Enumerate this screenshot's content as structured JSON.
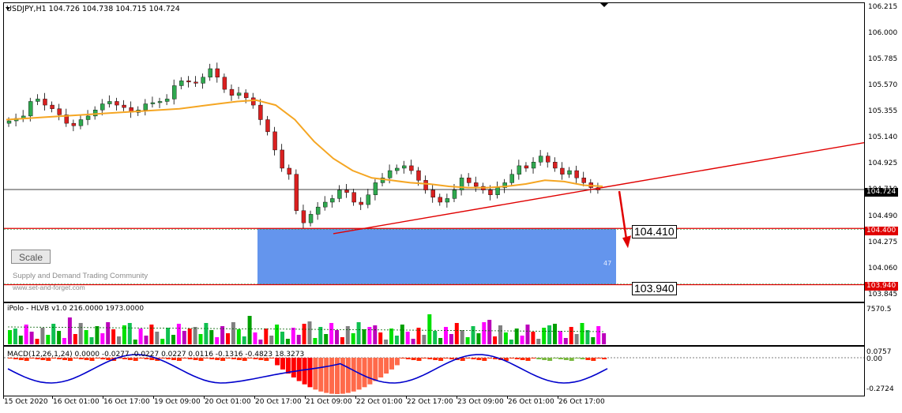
{
  "symbol_header": {
    "text": "USDJPY,H1  104.726 104.738 104.715 104.724"
  },
  "scale_button": {
    "label": "Scale"
  },
  "watermark": {
    "line1": "Supply and Demand Trading Community",
    "line2": "www.set-and-forget.com"
  },
  "zone": {
    "top_label": "104.410",
    "bottom_label": "103.940",
    "count_label": "47",
    "fill_color": "#6495ed"
  },
  "price_tags": {
    "current": "104.724",
    "zone_top": "104.400",
    "zone_bottom": "103.940"
  },
  "price_axis": [
    "106.215",
    "106.000",
    "105.785",
    "105.570",
    "105.355",
    "105.140",
    "104.925",
    "104.710",
    "104.490",
    "104.275",
    "104.060",
    "103.845"
  ],
  "volume_pane": {
    "header": "iPolo - HLVB v1.0 216.0000 1973.0000",
    "axis_max": "7570.5"
  },
  "macd_pane": {
    "header": "MACD(12,26,1,24) 0.0000 -0.0277 -0.0227 0.0227 0.0116 -0.1316 -0.4823 18.3273",
    "axis_top": "0.0757",
    "axis_zero": "0.00",
    "axis_bottom": "-0.2724"
  },
  "time_axis": [
    "15 Oct 2020",
    "16 Oct 01:00",
    "16 Oct 17:00",
    "19 Oct 09:00",
    "20 Oct 01:00",
    "20 Oct 17:00",
    "21 Oct 09:00",
    "22 Oct 01:00",
    "22 Oct 17:00",
    "23 Oct 09:00",
    "26 Oct 01:00",
    "26 Oct 17:00"
  ],
  "colors": {
    "bull_candle": "#2fa84f",
    "bear_candle": "#d92020",
    "moving_average": "#f5a623",
    "trendline": "#e00000",
    "macd_line": "#0000cc",
    "macd_hist_neg": "#ff2a00"
  },
  "chart_data": {
    "type": "line",
    "title": "USDJPY,H1",
    "ohlc_last": {
      "open": 104.726,
      "high": 104.738,
      "low": 104.715,
      "close": 104.724
    },
    "close_series": [
      105.29,
      105.31,
      105.33,
      105.45,
      105.47,
      105.42,
      105.39,
      105.34,
      105.27,
      105.25,
      105.3,
      105.33,
      105.38,
      105.43,
      105.45,
      105.42,
      105.4,
      105.36,
      105.38,
      105.43,
      105.44,
      105.45,
      105.47,
      105.58,
      105.62,
      105.61,
      105.6,
      105.65,
      105.72,
      105.65,
      105.55,
      105.5,
      105.52,
      105.48,
      105.42,
      105.3,
      105.2,
      105.05,
      104.9,
      104.85,
      104.55,
      104.45,
      104.52,
      104.58,
      104.62,
      104.65,
      104.72,
      104.7,
      104.62,
      104.6,
      104.68,
      104.78,
      104.82,
      104.88,
      104.9,
      104.92,
      104.88,
      104.8,
      104.72,
      104.66,
      104.62,
      104.65,
      104.72,
      104.82,
      104.78,
      104.75,
      104.72,
      104.68,
      104.74,
      104.78,
      104.85,
      104.92,
      104.9,
      104.95,
      105.0,
      104.95,
      104.9,
      104.85,
      104.88,
      104.82,
      104.78,
      104.74,
      104.72
    ],
    "moving_average": [
      105.3,
      105.31,
      105.32,
      105.33,
      105.34,
      105.35,
      105.36,
      105.37,
      105.38,
      105.39,
      105.41,
      105.43,
      105.45,
      105.46,
      105.42,
      105.3,
      105.12,
      104.98,
      104.88,
      104.82,
      104.8,
      104.78,
      104.77,
      104.75,
      104.74,
      104.74,
      104.75,
      104.77,
      104.8,
      104.79,
      104.76,
      104.75
    ],
    "ylim": [
      103.8,
      106.26
    ],
    "demand_zone": [
      103.94,
      104.41
    ],
    "current_price": 104.724
  }
}
